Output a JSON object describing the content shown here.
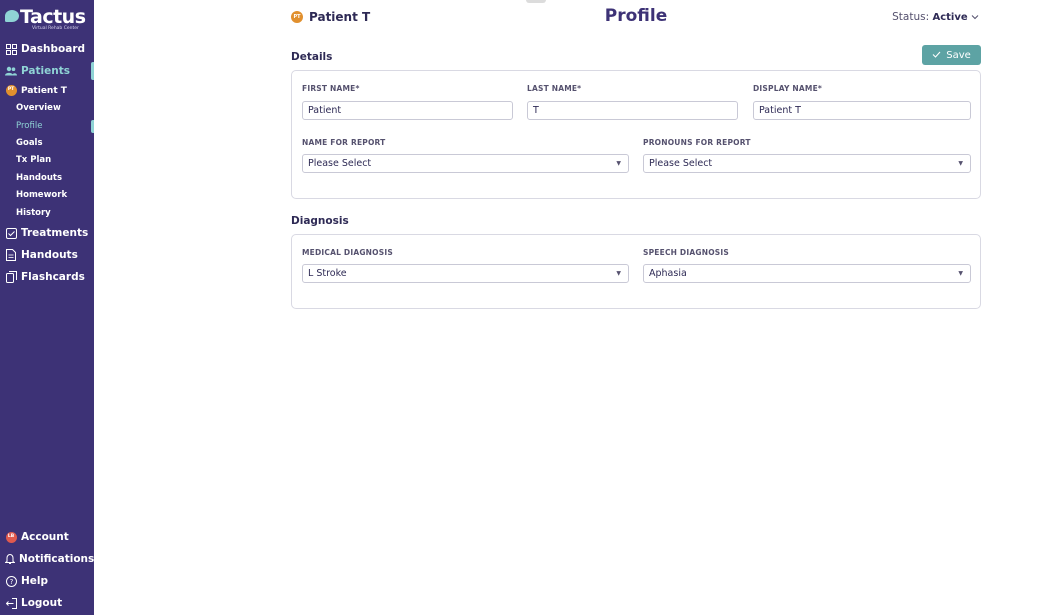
{
  "brand": {
    "name": "Tactus",
    "tagline": "Virtual Rehab Center"
  },
  "sidebar": {
    "items": [
      {
        "label": "Dashboard",
        "icon": "grid-icon"
      },
      {
        "label": "Patients",
        "icon": "users-icon",
        "active": true
      },
      {
        "label": "Treatments",
        "icon": "treatments-icon"
      },
      {
        "label": "Handouts",
        "icon": "document-icon"
      },
      {
        "label": "Flashcards",
        "icon": "flashcards-icon"
      }
    ],
    "patient": {
      "initials": "PT",
      "name": "Patient T",
      "subitems": [
        "Overview",
        "Profile",
        "Goals",
        "Tx Plan",
        "Handouts",
        "Homework",
        "History"
      ],
      "current": "Profile"
    },
    "bottom": [
      {
        "label": "Account",
        "icon": "avatar-icon",
        "initials": "LB"
      },
      {
        "label": "Notifications",
        "icon": "bell-icon"
      },
      {
        "label": "Help",
        "icon": "help-icon"
      },
      {
        "label": "Logout",
        "icon": "logout-icon"
      }
    ]
  },
  "header": {
    "patient_initials": "PT",
    "patient_name": "Patient T",
    "title": "Profile",
    "status_label": "Status:",
    "status_value": "Active"
  },
  "actions": {
    "save_label": "Save"
  },
  "details": {
    "title": "Details",
    "first_name": {
      "label": "FIRST NAME*",
      "value": "Patient"
    },
    "last_name": {
      "label": "LAST NAME*",
      "value": "T"
    },
    "display_name": {
      "label": "DISPLAY NAME*",
      "value": "Patient T"
    },
    "name_for_report": {
      "label": "NAME FOR REPORT",
      "value": "Please Select"
    },
    "pronouns_for_report": {
      "label": "PRONOUNS FOR REPORT",
      "value": "Please Select"
    }
  },
  "diagnosis": {
    "title": "Diagnosis",
    "medical": {
      "label": "MEDICAL DIAGNOSIS",
      "value": "L Stroke"
    },
    "speech": {
      "label": "SPEECH DIAGNOSIS",
      "value": "Aphasia"
    }
  },
  "colors": {
    "sidebar_bg": "#3d3276",
    "accent": "#8fd3d5",
    "save_button": "#5da3a4",
    "badge_patient": "#e1902e",
    "badge_account": "#e05a4e"
  }
}
